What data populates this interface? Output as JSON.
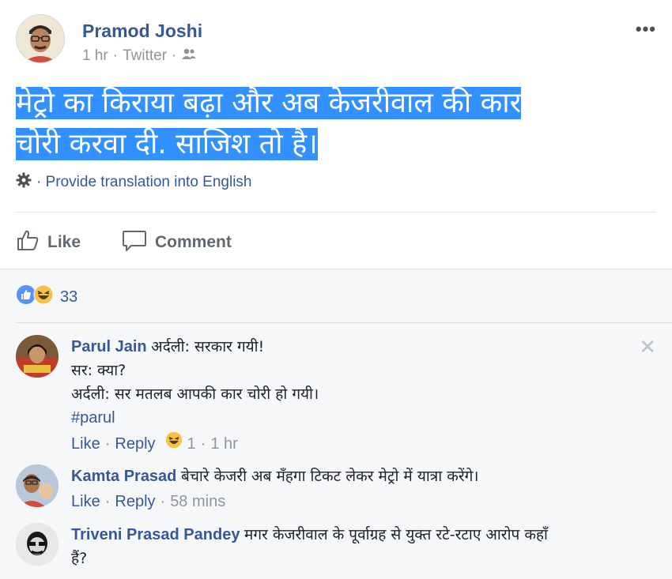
{
  "post": {
    "author": "Pramod Joshi",
    "time": "1 hr",
    "source": "Twitter",
    "separator": "·",
    "text_line1": "मेट्रो का किराया बढ़ा और अब केजरीवाल की कार",
    "text_line2": "चोरी करवा दी. साजिश तो है।",
    "translate": "· Provide translation into English"
  },
  "actions": {
    "like": "Like",
    "comment": "Comment"
  },
  "reactions": {
    "count": "33"
  },
  "comments": [
    {
      "author": "Parul Jain",
      "lines": [
        "अर्दली: सरकार गयी!",
        "सर: क्या?",
        "अर्दली: सर मतलब आपकी कार चोरी हो गयी।"
      ],
      "hashtag": "#parul",
      "like": "Like",
      "reply": "Reply",
      "reaction_count": "1",
      "time": "1 hr"
    },
    {
      "author": "Kamta Prasad",
      "text": "बेचारे केजरी अब मँहगा टिकट लेकर मेट्रो में यात्रा करेंगे।",
      "like": "Like",
      "reply": "Reply",
      "time": "58 mins"
    },
    {
      "author": "Triveni Prasad Pandey",
      "text_line1": "मगर केजरीवाल के पूर्वाग्रह से युक्त रटे-रटाए आरोप कहाँ",
      "text_line2": "हैं?"
    }
  ],
  "colors": {
    "link": "#365899",
    "muted": "#90949c",
    "highlight": "#3390ff",
    "comments_bg": "#f6f7f9"
  }
}
